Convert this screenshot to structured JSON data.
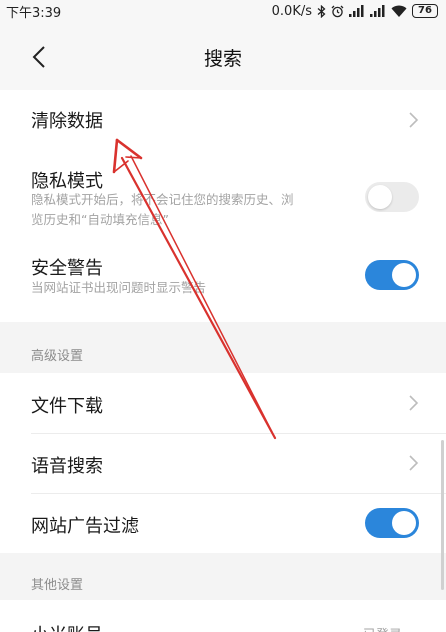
{
  "status_bar": {
    "time": "下午3:39",
    "network_speed": "0.0K/s",
    "battery": "76"
  },
  "header": {
    "back_icon": "chevron-left-icon",
    "title": "搜索"
  },
  "main": {
    "clear_data": {
      "label": "清除数据"
    },
    "private_mode": {
      "label": "隐私模式",
      "description_line1": "隐私模式开始后，将不会记住您的搜索历史、浏",
      "description_line2": "览历史和“自动填充信息”",
      "enabled": false
    },
    "security_warning": {
      "label": "安全警告",
      "description": "当网站证书出现问题时显示警告",
      "enabled": true
    }
  },
  "advanced": {
    "header": "高级设置",
    "file_download": {
      "label": "文件下载"
    },
    "voice_search": {
      "label": "语音搜索"
    },
    "ad_filter": {
      "label": "网站广告过滤",
      "enabled": true
    }
  },
  "other": {
    "header": "其他设置",
    "mi_account": {
      "label": "小米账号",
      "status": "已登录"
    }
  },
  "colors": {
    "accent": "#2b86db",
    "annotation_arrow": "#d9322e",
    "background": "#f4f4f4"
  }
}
